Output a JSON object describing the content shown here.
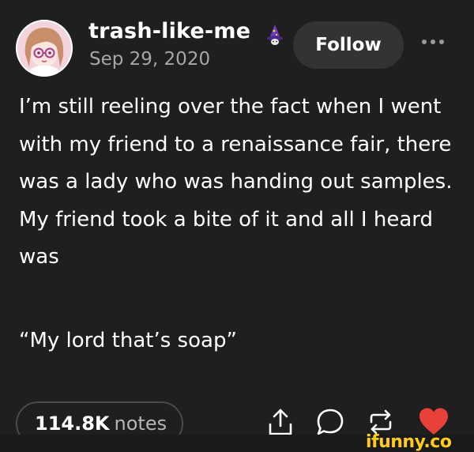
{
  "author": {
    "username": "trash-like-me",
    "badge_icon": "wizard-hat-icon",
    "date": "Sep 29, 2020"
  },
  "header": {
    "follow_label": "Follow",
    "more_icon": "more-horizontal-icon"
  },
  "post": {
    "body": "I’m still reeling over the fact when I went with my friend to a renaissance fair, there was a lady who was handing out samples. My friend took a bite of it and all I heard was",
    "quote": "“My lord that’s soap”"
  },
  "footer": {
    "notes_count": "114.8K",
    "notes_label": "notes",
    "actions": [
      "share-icon",
      "reply-icon",
      "reblog-icon",
      "like-icon"
    ]
  },
  "watermark": {
    "text": "ifunny.co"
  },
  "colors": {
    "background": "#1f1f1f",
    "text": "#ffffff",
    "muted": "#a7a7a7",
    "button_bg": "#333333",
    "like": "#e8413a",
    "watermark": "#ffcc1a"
  }
}
